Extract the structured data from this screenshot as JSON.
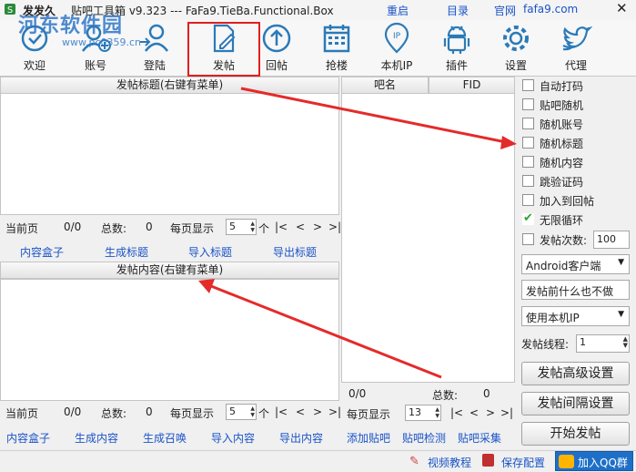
{
  "window": {
    "app_name": "发发久",
    "title": "贴吧工具箱 v9.323 --- FaFa9.TieBa.Functional.Box",
    "links": [
      "重启",
      "目录",
      "官网",
      "fafa9.com"
    ],
    "watermark": "河东软件园",
    "watermark_url": "www.pc0359.cn"
  },
  "toolbar": {
    "items": [
      {
        "label": "欢迎",
        "icon": "welcome-icon"
      },
      {
        "label": "账号",
        "icon": "account-icon"
      },
      {
        "label": "登陆",
        "icon": "login-icon"
      },
      {
        "label": "发帖",
        "icon": "post-icon"
      },
      {
        "label": "回帖",
        "icon": "reply-icon"
      },
      {
        "label": "抢楼",
        "icon": "grab-floor-icon"
      },
      {
        "label": "本机IP",
        "icon": "ip-icon"
      },
      {
        "label": "插件",
        "icon": "android-icon"
      },
      {
        "label": "设置",
        "icon": "gear-icon"
      },
      {
        "label": "代理",
        "icon": "twitter-bird-icon"
      }
    ]
  },
  "title_panel": {
    "header": "发帖标题(右键有菜单)",
    "pager": {
      "current_label": "当前页",
      "current": "0/0",
      "total_label": "总数:",
      "total": "0",
      "per_page_label": "每页显示",
      "per_page": "5",
      "unit": "个"
    },
    "nav": [
      "|<",
      "<",
      ">",
      ">|"
    ],
    "actions": [
      "内容盒子",
      "生成标题",
      "导入标题",
      "导出标题"
    ]
  },
  "content_panel": {
    "header": "发帖内容(右键有菜单)",
    "pager": {
      "current_label": "当前页",
      "current": "0/0",
      "total_label": "总数:",
      "total": "0",
      "per_page_label": "每页显示",
      "per_page": "5",
      "unit": "个"
    },
    "nav": [
      "|<",
      "<",
      ">",
      ">|"
    ],
    "actions": [
      "内容盒子",
      "生成内容",
      "生成召唤",
      "导入内容",
      "导出内容"
    ]
  },
  "bar_table": {
    "columns": [
      "吧名",
      "FID"
    ],
    "pager": {
      "current": "0/0",
      "total_label": "总数:",
      "total": "0",
      "per_page_label": "每页显示",
      "per_page": "13"
    },
    "nav": [
      "|<",
      "<",
      ">",
      ">|"
    ],
    "actions": [
      "添加贴吧",
      "贴吧检测",
      "贴吧采集"
    ]
  },
  "options": {
    "checkboxes": [
      {
        "label": "自动打码",
        "checked": false
      },
      {
        "label": "贴吧随机",
        "checked": false
      },
      {
        "label": "随机账号",
        "checked": false
      },
      {
        "label": "随机标题",
        "checked": false
      },
      {
        "label": "随机内容",
        "checked": false
      },
      {
        "label": "跳验证码",
        "checked": false
      },
      {
        "label": "加入到回帖",
        "checked": false
      },
      {
        "label": "无限循环",
        "checked": true
      },
      {
        "label": "发帖次数:",
        "checked": false
      }
    ],
    "post_count": "100",
    "client_select": "Android客户端",
    "before_post_select": "发帖前什么也不做",
    "ip_select": "使用本机IP",
    "threads_label": "发帖线程:",
    "threads": "1",
    "buttons": [
      "发帖高级设置",
      "发帖间隔设置",
      "开始发帖"
    ]
  },
  "statusbar": {
    "tutorial": "视频教程",
    "save": "保存配置",
    "qq": "加入QQ群"
  },
  "colors": {
    "accent_red": "#e52a2a",
    "link_blue": "#1a53c8",
    "check_green": "#2aa52a",
    "qq_blue": "#1e6fc8"
  }
}
